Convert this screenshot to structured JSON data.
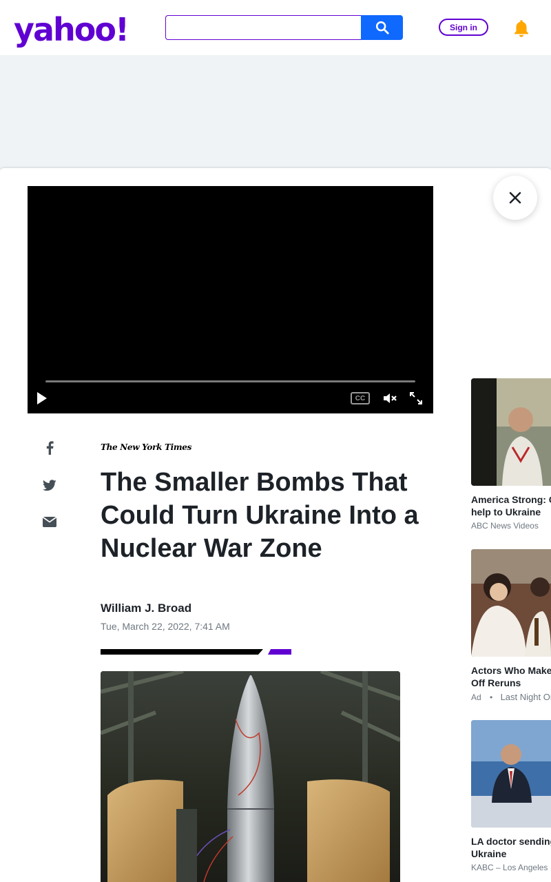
{
  "header": {
    "logo_text": "yahoo!",
    "search_placeholder": "",
    "signin_label": "Sign in",
    "brand_color": "#6001d2",
    "search_button_color": "#0f69ff"
  },
  "video": {
    "cc_label": "CC",
    "controls": [
      "play-icon",
      "closed-captions-icon",
      "mute-icon",
      "fullscreen-icon"
    ]
  },
  "share": {
    "icons": [
      "facebook-icon",
      "twitter-icon",
      "email-icon"
    ]
  },
  "article": {
    "publisher": "The New York Times",
    "headline": "The Smaller Bombs That Could Turn Ukraine Into a Nuclear War Zone",
    "author": "William J. Broad",
    "date": "Tue, March 22, 2022, 7:41 AM"
  },
  "sidebar": {
    "items": [
      {
        "title_line1": "America Strong: C",
        "title_line2": "help to Ukraine",
        "source": "ABC News Videos",
        "ad": ""
      },
      {
        "title_line1": "Actors Who Make",
        "title_line2": "Off Reruns",
        "source": "Last Night On",
        "ad": "Ad"
      },
      {
        "title_line1": "LA doctor sending",
        "title_line2": "Ukraine",
        "source": "KABC – Los Angeles",
        "ad": ""
      }
    ]
  }
}
